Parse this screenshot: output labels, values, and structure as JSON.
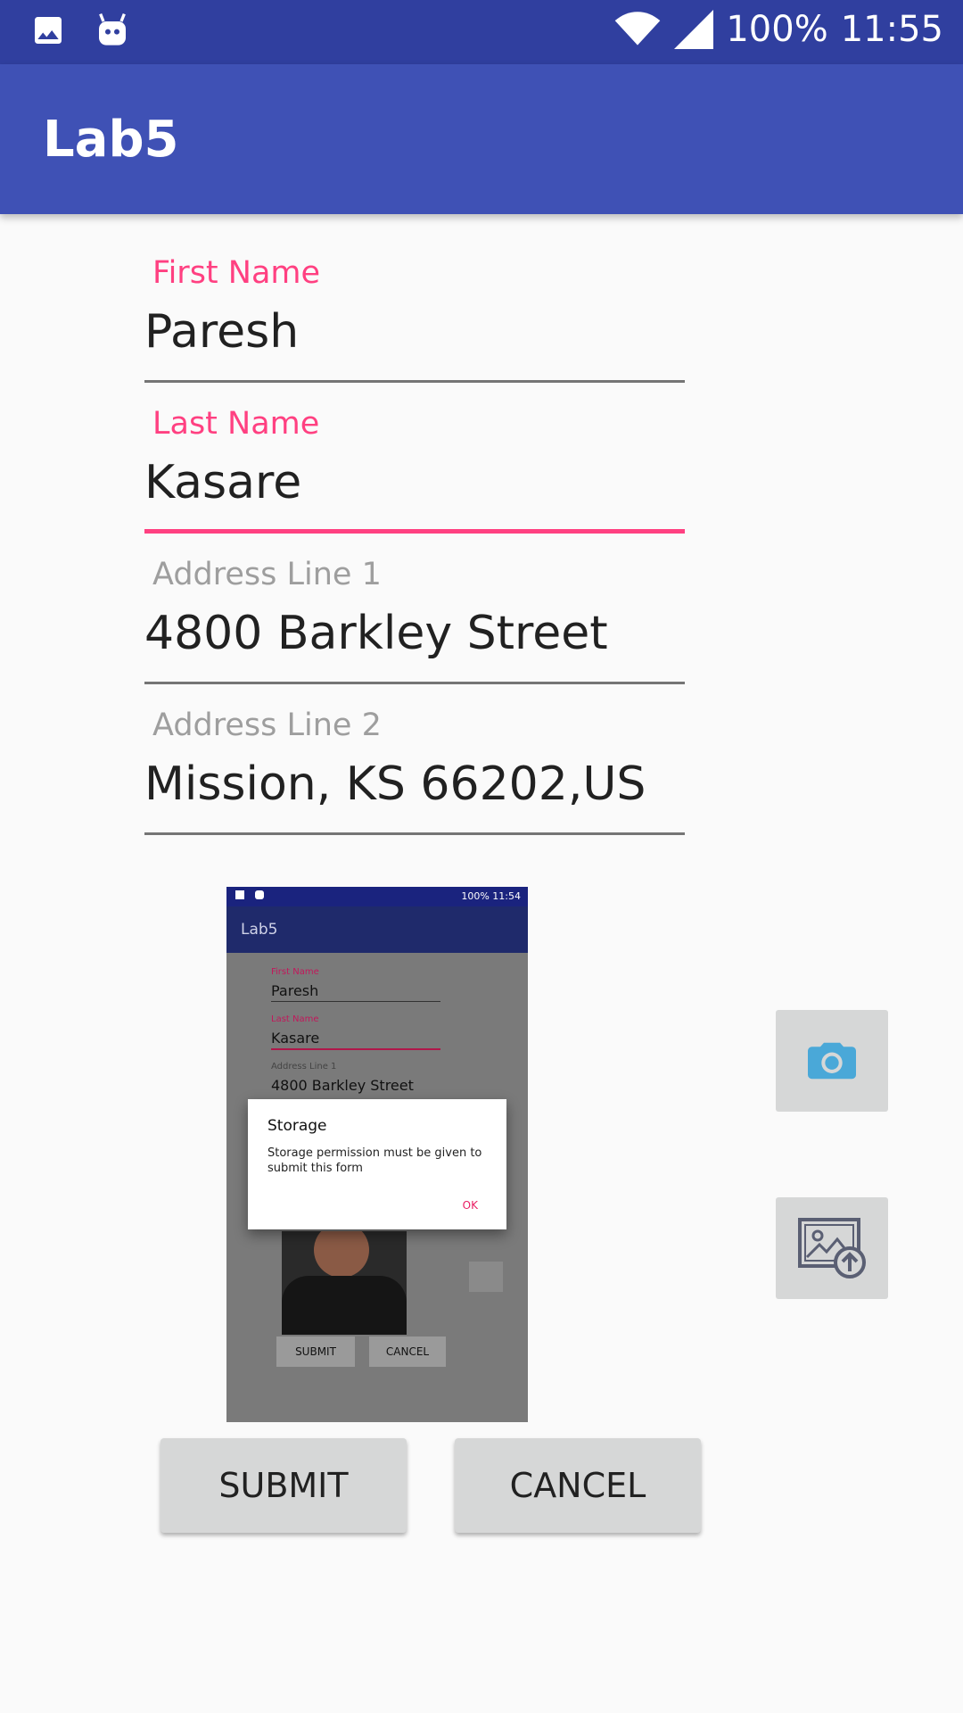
{
  "status_bar": {
    "battery": "100%",
    "time": "11:55",
    "icons": [
      "image-icon",
      "android-icon",
      "wifi-icon",
      "signal-icon"
    ]
  },
  "app_bar": {
    "title": "Lab5"
  },
  "form": {
    "first_name": {
      "label": "First Name",
      "value": "Paresh"
    },
    "last_name": {
      "label": "Last Name",
      "value": "Kasare"
    },
    "address1": {
      "label": "Address Line 1",
      "value": "4800 Barkley Street"
    },
    "address2": {
      "label": "Address Line 2",
      "value": "Mission, KS 66202,US"
    }
  },
  "thumbnail": {
    "status_bar": {
      "battery_time": "100% 11:54"
    },
    "app_title": "Lab5",
    "first_name": {
      "label": "First Name",
      "value": "Paresh"
    },
    "last_name": {
      "label": "Last Name",
      "value": "Kasare"
    },
    "address1": {
      "label": "Address Line 1",
      "value": "4800 Barkley Street"
    },
    "dialog": {
      "title": "Storage",
      "message": "Storage permission must be given to submit this form",
      "ok": "OK"
    },
    "submit": "SUBMIT",
    "cancel": "CANCEL"
  },
  "side_buttons": {
    "camera_icon": "camera-icon",
    "gallery_icon": "image-upload-icon"
  },
  "buttons": {
    "submit": "SUBMIT",
    "cancel": "CANCEL"
  },
  "colors": {
    "primary": "#3f51b5",
    "primary_dark": "#303f9f",
    "accent": "#ff4081",
    "camera_blue": "#4aa8d8"
  }
}
